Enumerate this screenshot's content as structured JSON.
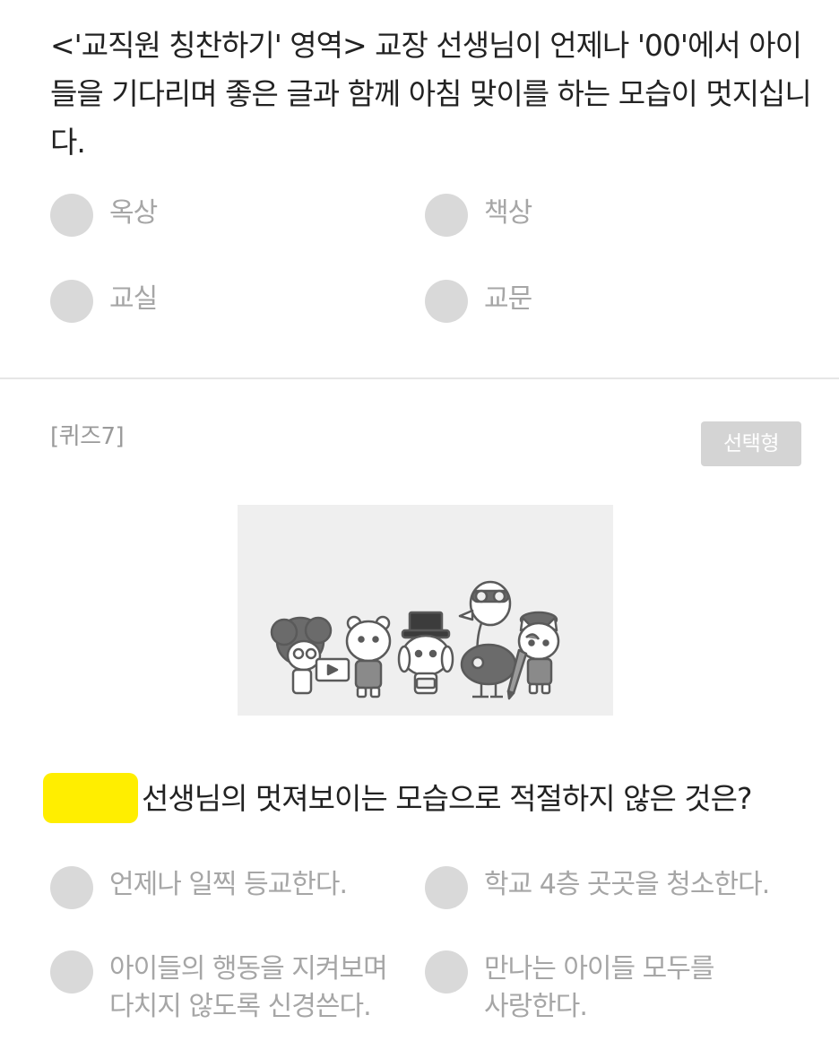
{
  "question1": {
    "text": "<'교직원 칭찬하기' 영역> 교장 선생님이 언제나 '00'에서 아이들을 기다리며 좋은 글과 함께 아침 맞이를 하는 모습이 멋지십니다.",
    "options": [
      "옥상",
      "책상",
      "교실",
      "교문"
    ]
  },
  "quiz7": {
    "number_label": "[퀴즈7]",
    "type_badge": "선택형",
    "question": "선생님의 멋져보이는 모습으로 적절하지 않은 것은?",
    "options": [
      "언제나 일찍 등교한다.",
      "학교 4층 곳곳을 청소한다.",
      "아이들의 행동을 지켜보며\n다치지 않도록 신경쓴다.",
      "만나는 아이들 모두를\n사랑한다."
    ],
    "highlight_color": "#ffee00"
  },
  "colors": {
    "radio": "#d9d9d9",
    "option_text": "#a6a6a6",
    "badge_bg": "#d4d4d4"
  }
}
